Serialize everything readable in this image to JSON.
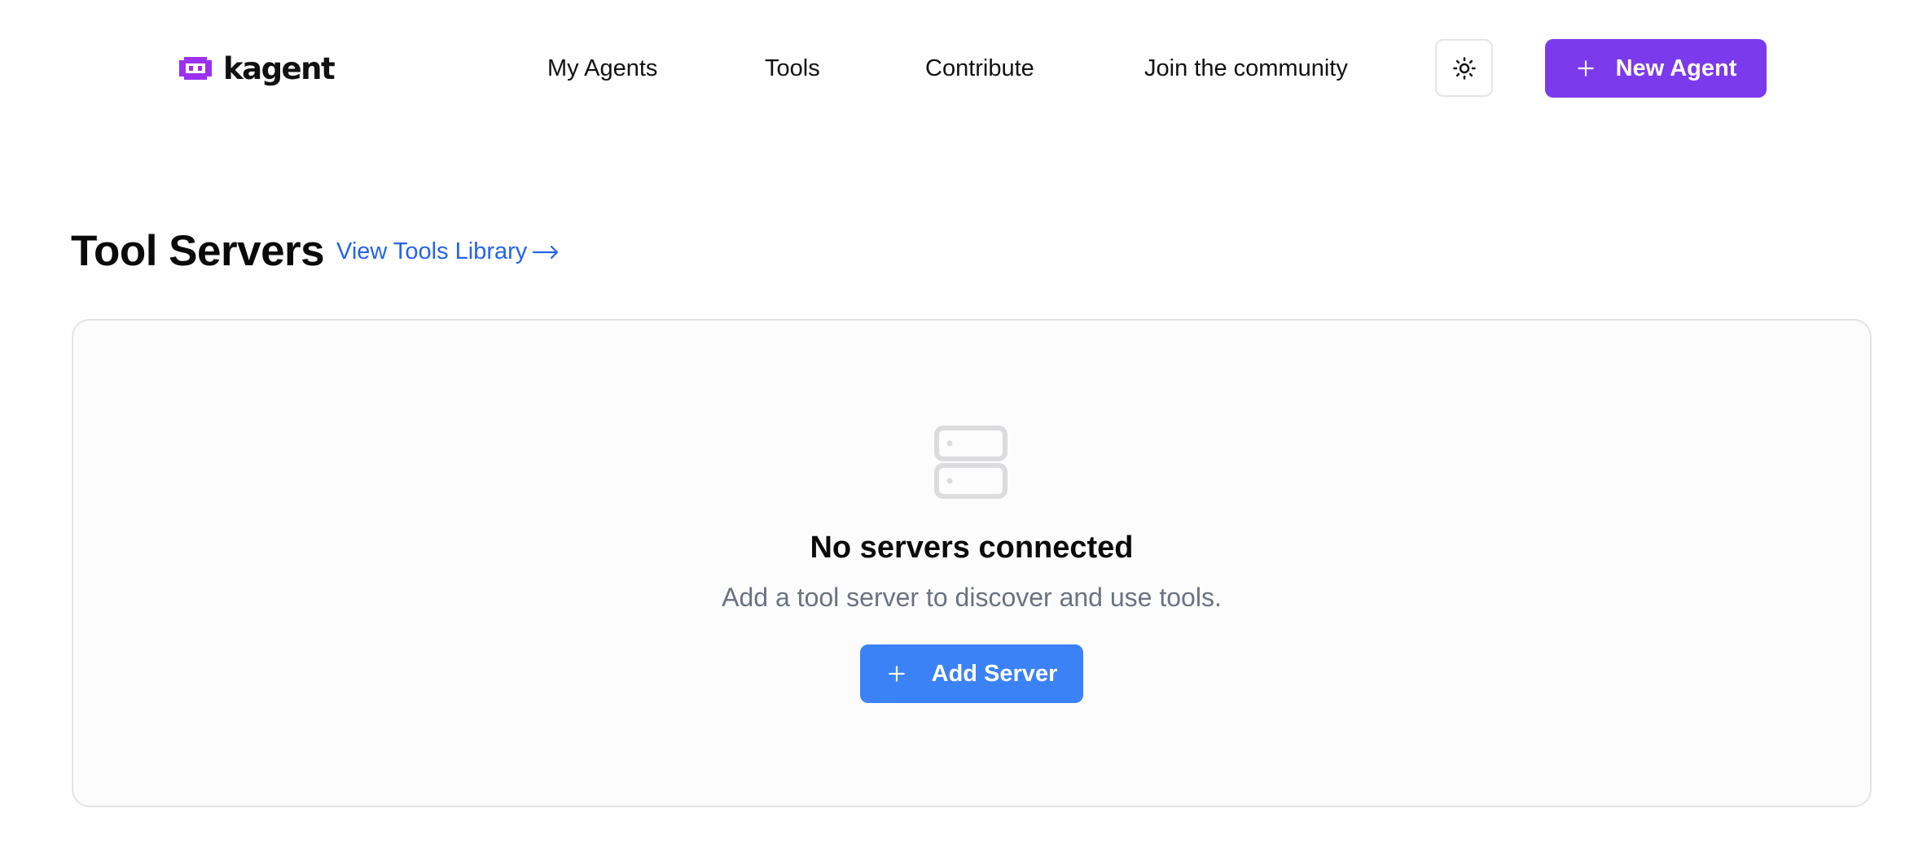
{
  "header": {
    "logo_text": "kagent",
    "nav": [
      {
        "label": "My Agents"
      },
      {
        "label": "Tools"
      },
      {
        "label": "Contribute"
      },
      {
        "label": "Join the community"
      }
    ],
    "theme_toggle_icon": "sun-icon",
    "new_agent_label": "New Agent"
  },
  "main": {
    "title": "Tool Servers",
    "library_link": "View Tools Library",
    "library_link_icon": "arrow-right-icon",
    "empty_state": {
      "icon": "server-icon",
      "title": "No servers connected",
      "description": "Add a tool server to discover and use tools.",
      "button_label": "Add Server"
    }
  },
  "colors": {
    "brand_purple": "#7c3aed",
    "primary_blue": "#3b82f6",
    "link_blue": "#2563eb",
    "muted_text": "#6b7280",
    "border": "#e4e4e7"
  }
}
